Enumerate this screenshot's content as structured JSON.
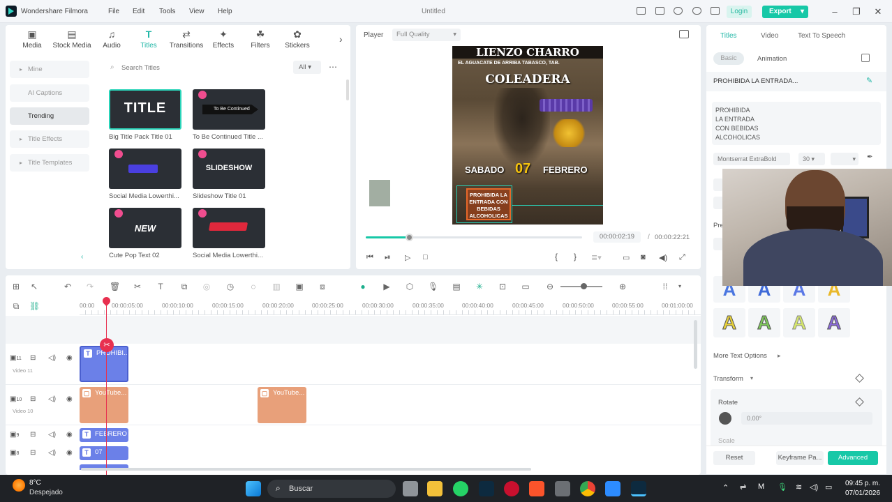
{
  "app": {
    "name": "Wondershare Filmora",
    "title": "Untitled",
    "login": "Login",
    "export": "Export"
  },
  "menu": [
    "File",
    "Edit",
    "Tools",
    "View",
    "Help"
  ],
  "toolbar": [
    {
      "label": "Media",
      "icon": "media-icon"
    },
    {
      "label": "Stock Media",
      "icon": "stock-media-icon"
    },
    {
      "label": "Audio",
      "icon": "audio-icon"
    },
    {
      "label": "Titles",
      "icon": "titles-icon"
    },
    {
      "label": "Transitions",
      "icon": "transitions-icon"
    },
    {
      "label": "Effects",
      "icon": "effects-icon"
    },
    {
      "label": "Filters",
      "icon": "filters-icon"
    },
    {
      "label": "Stickers",
      "icon": "stickers-icon"
    }
  ],
  "sidebar": [
    "Mine",
    "AI Captions",
    "Trending",
    "Title Effects",
    "Title Templates"
  ],
  "search": {
    "placeholder": "Search Titles",
    "filter": "All"
  },
  "thumbs": [
    {
      "label": "Big Title Pack Title 01",
      "text": "TITLE"
    },
    {
      "label": "To Be Continued Title ...",
      "text": "To Be Continued"
    },
    {
      "label": "Social Media Lowerthi...",
      "text": ""
    },
    {
      "label": "Slideshow Title 01",
      "text": "SLIDESHOW"
    },
    {
      "label": "Cute Pop Text 02",
      "text": "NEW"
    },
    {
      "label": "Social Media Lowerthi...",
      "text": ""
    }
  ],
  "player": {
    "label": "Player",
    "quality": "Full Quality",
    "current": "00:00:02:19",
    "total": "00:00:22:21",
    "separator": "/",
    "progress": 0.2
  },
  "poster": {
    "top": "LIENZO CHARRO",
    "sub": "EL AGUACATE DE ARRIBA TABASCO, TAB.",
    "mid": "COLEADERA",
    "date_day": "SABADO",
    "date_num": "07",
    "date_month": "FEBRERO",
    "notice": "PROHIBIDA LA ENTRADA CON BEBIDAS ALCOHOLICAS"
  },
  "props": {
    "tabs": [
      "Titles",
      "Video",
      "Text To Speech"
    ],
    "subtabs": [
      "Basic",
      "Animation"
    ],
    "header": "PROHIBIDA LA ENTRADA...",
    "text_lines": [
      "PROHIBIDA",
      "LA ENTRADA",
      "CON BEBIDAS",
      "ALCOHOLICAS"
    ],
    "font": "Montserrat ExtraBold",
    "size": "30",
    "preset_label": "Pre",
    "more_options": "More Text Options",
    "transform": "Transform",
    "rotate": "Rotate",
    "rotate_value": "0.00°",
    "scale": "Scale",
    "reset": "Reset",
    "keyframe": "Keyframe Pa...",
    "advanced": "Advanced"
  },
  "timeline": {
    "ruler": [
      "00:00",
      "00:00:05:00",
      "00:00:10:00",
      "00:00:15:00",
      "00:00:20:00",
      "00:00:25:00",
      "00:00:30:00",
      "00:00:35:00",
      "00:00:40:00",
      "00:00:45:00",
      "00:00:50:00",
      "00:00:55:00",
      "00:01:00:00"
    ],
    "tracks": [
      {
        "num": "11",
        "name": "Video 11"
      },
      {
        "num": "10",
        "name": "Video 10"
      },
      {
        "num": "9",
        "name": ""
      },
      {
        "num": "8",
        "name": ""
      }
    ],
    "clips": {
      "title": "PROHIBI...",
      "yt1": "YouTube...",
      "yt2": "YouTube...",
      "febrero": "FEBRERO",
      "num07": "07"
    }
  },
  "taskbar": {
    "temp": "8°C",
    "weather": "Despejado",
    "search": "Buscar",
    "time": "09:45 p. m.",
    "date": "07/01/2026"
  },
  "colors": {
    "accent": "#17c8a7",
    "title_clip": "#6b80e8",
    "video_clip": "#e8a07a"
  }
}
